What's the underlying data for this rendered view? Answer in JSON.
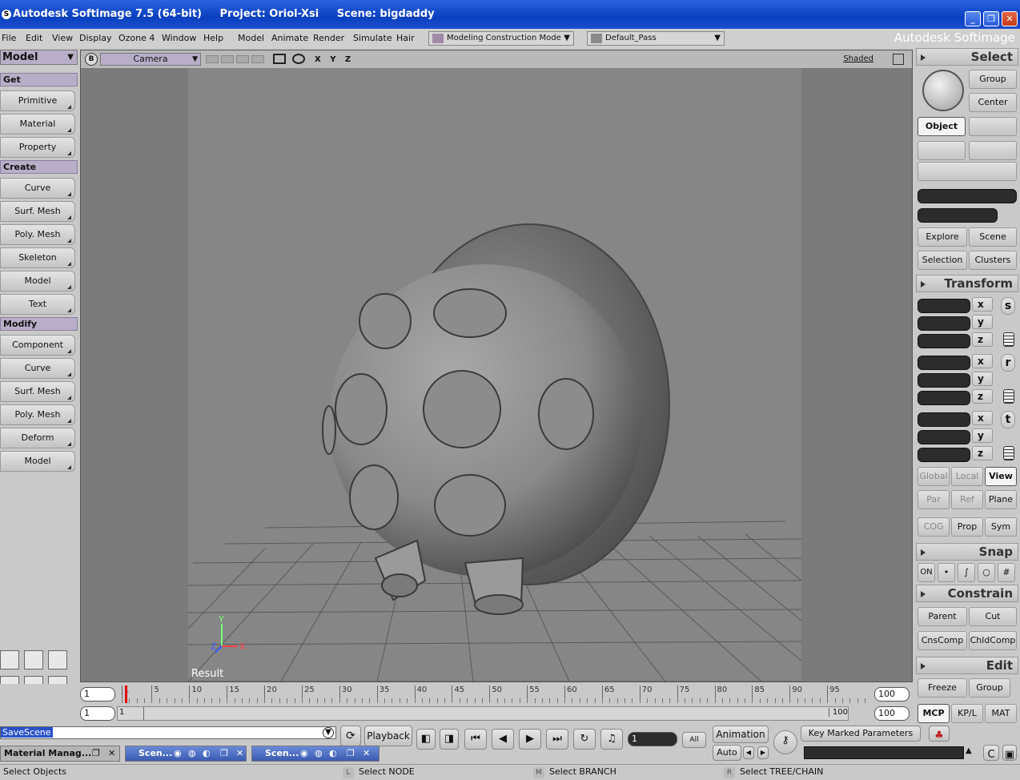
{
  "window": {
    "app_title": "Autodesk Softimage 7.5 (64-bit)",
    "project": "Project: Oriol-Xsi",
    "scene": "Scene: bigdaddy",
    "brand": "Autodesk Softimage"
  },
  "menu": {
    "items": [
      "File",
      "Edit",
      "View",
      "Display",
      "Ozone 4",
      "Window",
      "Help",
      "Model",
      "Animate",
      "Render",
      "Simulate",
      "Hair"
    ],
    "mode_combo": "Modeling Construction Mode",
    "pass_combo": "Default_Pass"
  },
  "left": {
    "module": "Model",
    "get_header": "Get",
    "get_items": [
      "Primitive",
      "Material",
      "Property"
    ],
    "create_header": "Create",
    "create_items": [
      "Curve",
      "Surf. Mesh",
      "Poly. Mesh",
      "Skeleton",
      "Model",
      "Text"
    ],
    "modify_header": "Modify",
    "modify_items": [
      "Component",
      "Curve",
      "Surf. Mesh",
      "Poly. Mesh",
      "Deform",
      "Model"
    ]
  },
  "viewport": {
    "badge": "B",
    "camera": "Camera",
    "axes": "X Y Z",
    "shading": "Shaded",
    "result": "Result"
  },
  "right": {
    "select": {
      "header": "Select",
      "group": "Group",
      "center": "Center",
      "object": "Object",
      "explore": "Explore",
      "scene": "Scene",
      "selection": "Selection",
      "clusters": "Clusters"
    },
    "transform": {
      "header": "Transform",
      "x": "x",
      "y": "y",
      "z": "z",
      "s": "s",
      "r": "r",
      "t": "t",
      "global": "Global",
      "local": "Local",
      "view": "View",
      "par": "Par",
      "ref": "Ref",
      "plane": "Plane",
      "cog": "COG",
      "prop": "Prop",
      "sym": "Sym"
    },
    "snap": {
      "header": "Snap",
      "on": "ON"
    },
    "constrain": {
      "header": "Constrain",
      "parent": "Parent",
      "cut": "Cut",
      "cnscomp": "CnsComp",
      "chldcomp": "ChldComp"
    },
    "edit": {
      "header": "Edit",
      "freeze": "Freeze",
      "group": "Group",
      "mcp": "MCP",
      "kpl": "KP/L",
      "mat": "MAT"
    }
  },
  "timeline": {
    "current_frame": "1",
    "ruler_labels": [
      "1",
      "5",
      "10",
      "15",
      "20",
      "25",
      "30",
      "35",
      "40",
      "45",
      "50",
      "55",
      "60",
      "65",
      "70",
      "75",
      "80",
      "85",
      "90",
      "95"
    ],
    "end_frame": "100",
    "range_start": "1",
    "range_start_inner": "1",
    "range_end_inner": "100",
    "range_end": "100"
  },
  "bottom": {
    "command": "SaveScene",
    "playback": "Playback",
    "frame_field": "1",
    "all": "All",
    "animation": "Animation",
    "auto": "Auto",
    "key_marked": "Key Marked Parameters",
    "task_material": "Material Manag...",
    "task_scene1": "Scen...",
    "task_scene2": "Scen..."
  },
  "status": {
    "left": "Select Objects",
    "l_key": "L",
    "l_text": "Select NODE",
    "m_key": "M",
    "m_text": "Select BRANCH",
    "r_key": "R",
    "r_text": "Select TREE/CHAIN"
  }
}
